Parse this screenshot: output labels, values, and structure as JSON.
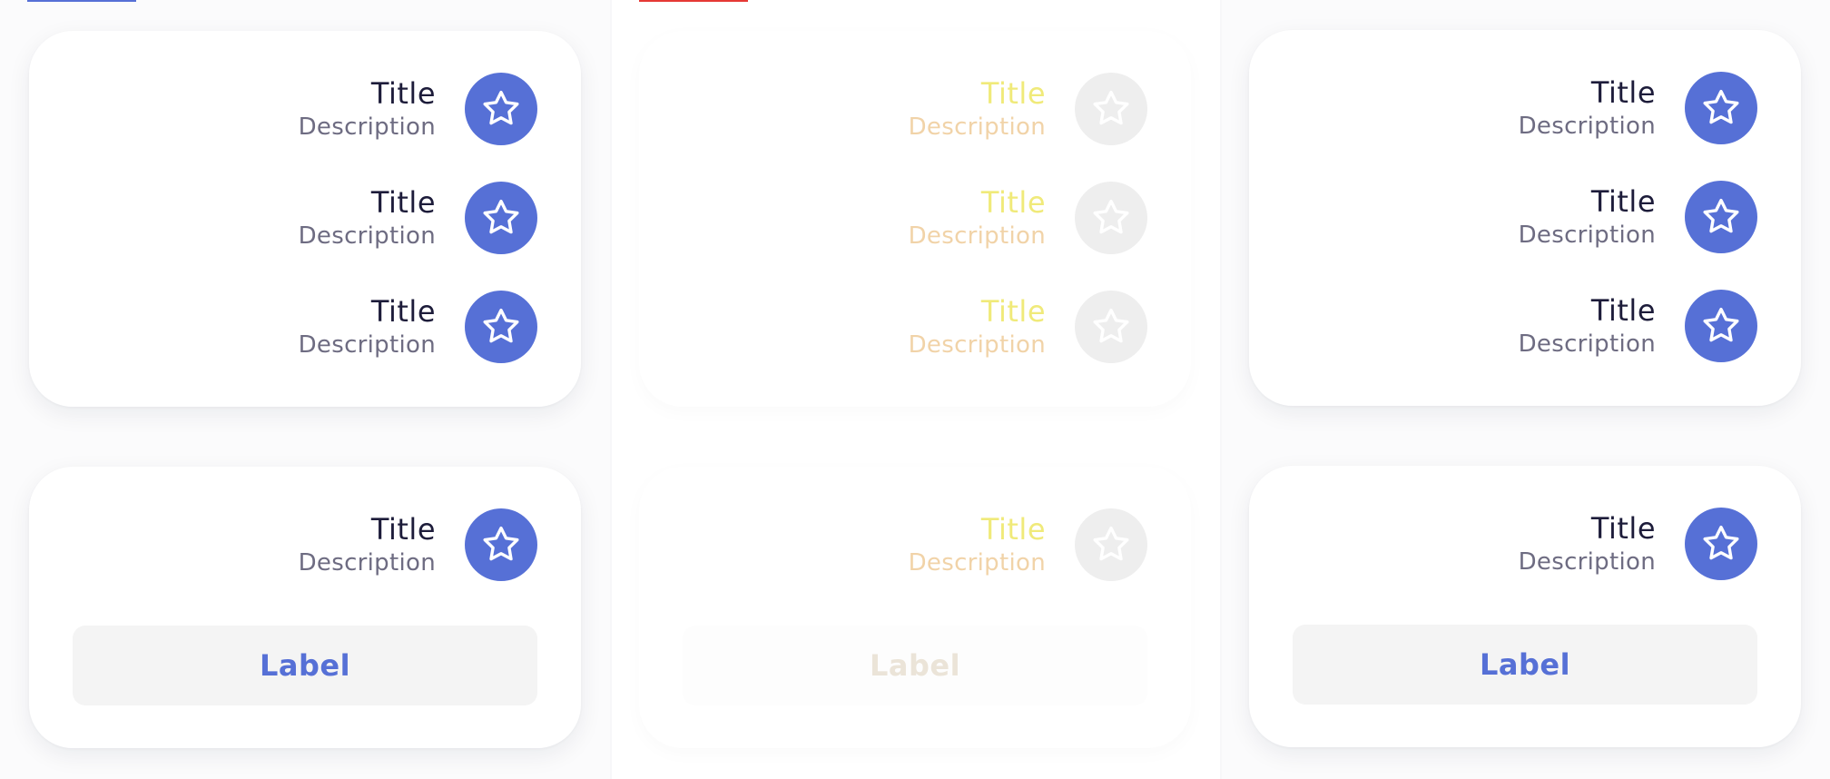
{
  "colors": {
    "accent": "#5670d6",
    "ghost_icon_bg": "#eeeeee",
    "top_rule_left": "#5670d6",
    "top_rule_mid": "#e53935"
  },
  "columns": [
    {
      "variant": "normal",
      "list_card": {
        "items": [
          {
            "title": "Title",
            "description": "Description",
            "icon": "star-icon"
          },
          {
            "title": "Title",
            "description": "Description",
            "icon": "star-icon"
          },
          {
            "title": "Title",
            "description": "Description",
            "icon": "star-icon"
          }
        ]
      },
      "action_card": {
        "item": {
          "title": "Title",
          "description": "Description",
          "icon": "star-icon"
        },
        "button_label": "Label"
      }
    },
    {
      "variant": "ghost",
      "list_card": {
        "items": [
          {
            "title": "Title",
            "description": "Description",
            "icon": "star-icon"
          },
          {
            "title": "Title",
            "description": "Description",
            "icon": "star-icon"
          },
          {
            "title": "Title",
            "description": "Description",
            "icon": "star-icon"
          }
        ]
      },
      "action_card": {
        "item": {
          "title": "Title",
          "description": "Description",
          "icon": "star-icon"
        },
        "button_label": "Label"
      }
    },
    {
      "variant": "normal",
      "list_card": {
        "items": [
          {
            "title": "Title",
            "description": "Description",
            "icon": "star-icon"
          },
          {
            "title": "Title",
            "description": "Description",
            "icon": "star-icon"
          },
          {
            "title": "Title",
            "description": "Description",
            "icon": "star-icon"
          }
        ]
      },
      "action_card": {
        "item": {
          "title": "Title",
          "description": "Description",
          "icon": "star-icon"
        },
        "button_label": "Label"
      }
    }
  ]
}
